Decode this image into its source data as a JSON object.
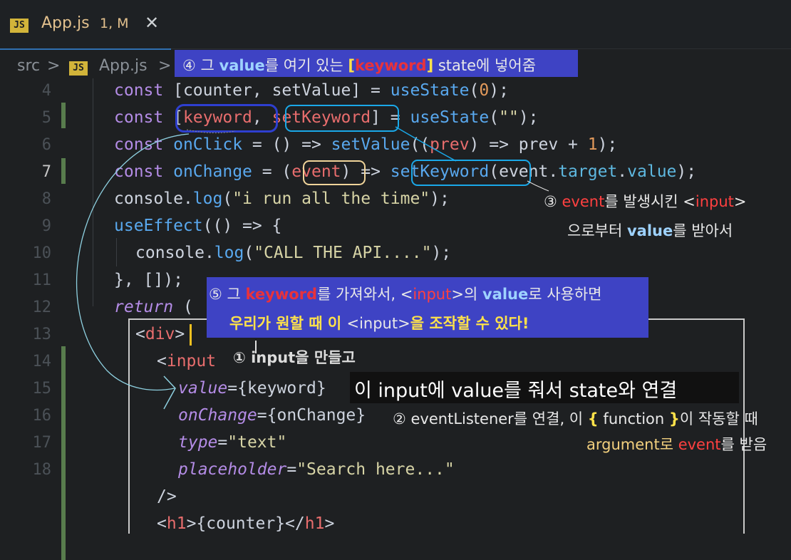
{
  "tab": {
    "icon": "JS",
    "filename": "App.js",
    "status": "1, M",
    "close": "✕"
  },
  "breadcrumb": {
    "folder": "src",
    "sep": ">",
    "icon": "JS",
    "file": "App.js",
    "sep2": ">"
  },
  "line_numbers": [
    "4",
    "5",
    "6",
    "7",
    "8",
    "9",
    "10",
    "11",
    "12",
    "13",
    "14",
    "15",
    "16",
    "17",
    "18"
  ],
  "code": {
    "l4": [
      "const",
      " [counter, setValue] = ",
      "useState",
      "(",
      "0",
      ");"
    ],
    "l5": [
      "const",
      " [",
      "keyword",
      ", ",
      "setKeyword",
      "] = ",
      "useState",
      "(",
      "\"\"",
      ");"
    ],
    "l6": [
      "const",
      " ",
      "onClick",
      " = () => ",
      "setValue",
      "((",
      "prev",
      ") => prev + ",
      "1",
      ");"
    ],
    "l7": [
      "const",
      " ",
      "onChange",
      " = (",
      "event",
      ") => ",
      "setKeyword",
      "(event.",
      "target",
      ".",
      "value",
      ");"
    ],
    "l8": [
      "console",
      ".",
      "log",
      "(",
      "\"i run all the time\"",
      ");"
    ],
    "l9": [
      "useEffect",
      "(() => {"
    ],
    "l10": [
      "console",
      ".",
      "log",
      "(",
      "\"CALL THE API....\"",
      ");"
    ],
    "l11": [
      "}, []);"
    ],
    "l12": [
      "return",
      " ("
    ],
    "l13": [
      "<",
      "div",
      ">"
    ],
    "l14": [
      "<",
      "input"
    ],
    "l15": [
      "value",
      "=",
      "{keyword}"
    ],
    "l16": [
      "onChange",
      "=",
      "{onChange}"
    ],
    "l17": [
      "type",
      "=",
      "\"text\""
    ],
    "l18": [
      "placeholder",
      "=",
      "\"Search here...\""
    ],
    "l19": [
      "/>"
    ],
    "l20": [
      "<",
      "h1",
      ">{counter}</",
      "h1",
      ">"
    ]
  },
  "annotations": {
    "a4": [
      "④ 그 ",
      "value",
      "를 여기 있는 ",
      "[",
      "keyword",
      "]",
      " state에 넣어줌"
    ],
    "a3_line1": [
      "③ ",
      "event",
      "를 발생시킨 ",
      "<",
      "input",
      ">"
    ],
    "a3_line2": [
      "으로부터 ",
      "value",
      "를 받아서"
    ],
    "a5_line1": [
      "⑤ 그 ",
      "keyword",
      "를 가져와서, ",
      "<",
      "input",
      ">",
      "의 ",
      "value",
      "로 사용하면"
    ],
    "a5_line2": [
      "우리가 원할 때 이 ",
      "<input>",
      "을 조작할 수 있다!"
    ],
    "a1": "① input을 만들고",
    "subtitle": "이 input에 value를 줘서 state와 연결",
    "a2_line1": [
      "② eventListener를 연결, 이 ",
      "{",
      " function ",
      "}",
      "이 작동할 때"
    ],
    "a2_line2": [
      "argument로 ",
      "event",
      "를 받음"
    ]
  },
  "colors": {
    "annotation_box": "#3e43c4",
    "ring_cyan": "#1aa8e8",
    "ring_navy": "#2e3fd0",
    "ring_cream": "#f0d49a",
    "frame": "#c9c9c9",
    "tab_accent": "#e2c08d"
  }
}
